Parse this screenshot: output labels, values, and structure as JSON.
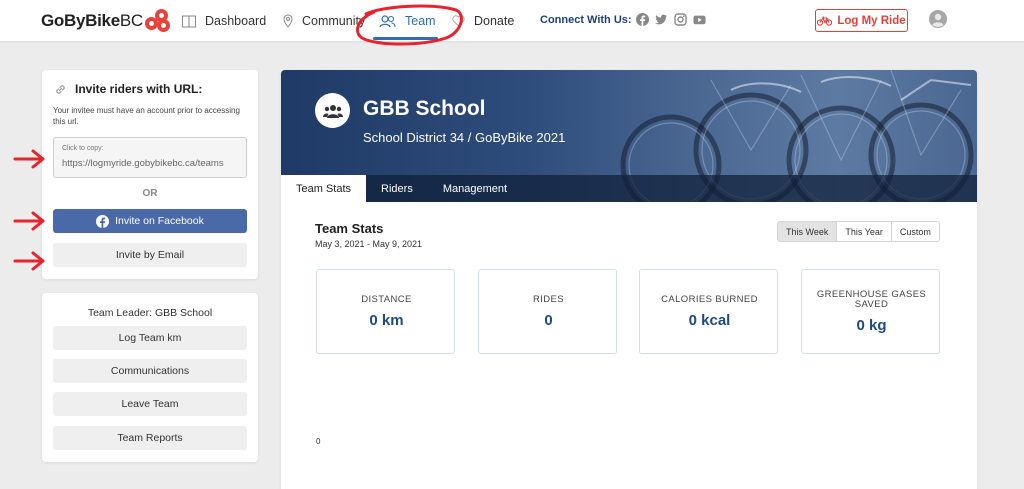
{
  "brand": {
    "name_bold": "GoByBike",
    "name_light": "BC"
  },
  "nav": {
    "items": [
      {
        "label": "Dashboard"
      },
      {
        "label": "Community"
      },
      {
        "label": "Team"
      },
      {
        "label": "Donate"
      }
    ],
    "connect_label": "Connect With Us:",
    "social": [
      "facebook-icon",
      "twitter-icon",
      "instagram-icon",
      "youtube-icon"
    ],
    "log_ride_label": "Log My Ride"
  },
  "invite": {
    "title": "Invite riders with URL:",
    "note": "Your invitee must have an account prior to accessing this url.",
    "copy_label": "Click to copy:",
    "copy_value": "https://logmyride.gobybikebc.ca/teams",
    "or_label": "OR",
    "facebook_label": "Invite on Facebook",
    "email_label": "Invite by Email"
  },
  "leader": {
    "title": "Team Leader: GBB School",
    "buttons": [
      {
        "label": "Log Team km"
      },
      {
        "label": "Communications"
      },
      {
        "label": "Leave Team"
      },
      {
        "label": "Team Reports"
      }
    ]
  },
  "team": {
    "name": "GBB School",
    "subtitle": "School District 34 / GoByBike 2021",
    "tabs": [
      {
        "label": "Team Stats"
      },
      {
        "label": "Riders"
      },
      {
        "label": "Management"
      }
    ]
  },
  "stats": {
    "title": "Team Stats",
    "range": "May 3, 2021 - May 9, 2021",
    "periods": [
      {
        "label": "This Week"
      },
      {
        "label": "This Year"
      },
      {
        "label": "Custom"
      }
    ],
    "cards": [
      {
        "label": "DISTANCE",
        "value": "0 km"
      },
      {
        "label": "RIDES",
        "value": "0"
      },
      {
        "label": "CALORIES BURNED",
        "value": "0 kcal"
      },
      {
        "label": "GREENHOUSE GASES SAVED",
        "value": "0 kg"
      }
    ],
    "axis_zero": "0"
  },
  "colors": {
    "brand_red": "#e0413b",
    "link_blue": "#2f6db5",
    "facebook_blue": "#4a69a9",
    "stat_value_blue": "#1f4a82",
    "annotation_red": "#e8232e"
  }
}
